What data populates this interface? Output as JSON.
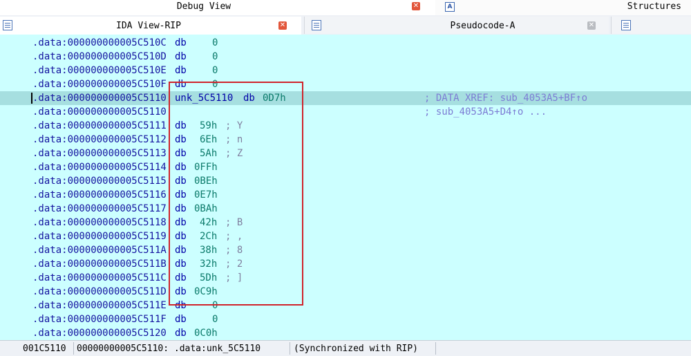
{
  "tabs_top": {
    "debug_view": "Debug View",
    "structures": "Structures"
  },
  "tabs": {
    "ida_view": "IDA View-RIP",
    "pseudocode": "Pseudocode-A"
  },
  "listing": {
    "lines": [
      {
        "addr": ".data:000000000005C510C",
        "ins": "db",
        "op": "0",
        "cmt": ""
      },
      {
        "addr": ".data:000000000005C510D",
        "ins": "db",
        "op": "0",
        "cmt": ""
      },
      {
        "addr": ".data:000000000005C510E",
        "ins": "db",
        "op": "0",
        "cmt": ""
      },
      {
        "addr": ".data:000000000005C510F",
        "ins": "db",
        "op": "0",
        "cmt": ""
      },
      {
        "addr": ".data:000000000005C5110",
        "name": "unk_5C5110",
        "ins": "db",
        "op": "0D7h",
        "xref": "; DATA XREF: sub_4053A5+BF↑o",
        "current": true
      },
      {
        "addr": ".data:000000000005C5110",
        "xref": "; sub_4053A5+D4↑o ..."
      },
      {
        "addr": ".data:000000000005C5111",
        "ins": "db",
        "op": "59h",
        "cmt": "; Y"
      },
      {
        "addr": ".data:000000000005C5112",
        "ins": "db",
        "op": "6Eh",
        "cmt": "; n"
      },
      {
        "addr": ".data:000000000005C5113",
        "ins": "db",
        "op": "5Ah",
        "cmt": "; Z"
      },
      {
        "addr": ".data:000000000005C5114",
        "ins": "db",
        "op": "0FFh",
        "cmt": ""
      },
      {
        "addr": ".data:000000000005C5115",
        "ins": "db",
        "op": "0BEh",
        "cmt": ""
      },
      {
        "addr": ".data:000000000005C5116",
        "ins": "db",
        "op": "0E7h",
        "cmt": ""
      },
      {
        "addr": ".data:000000000005C5117",
        "ins": "db",
        "op": "0BAh",
        "cmt": ""
      },
      {
        "addr": ".data:000000000005C5118",
        "ins": "db",
        "op": "42h",
        "cmt": "; B"
      },
      {
        "addr": ".data:000000000005C5119",
        "ins": "db",
        "op": "2Ch",
        "cmt": "; ,"
      },
      {
        "addr": ".data:000000000005C511A",
        "ins": "db",
        "op": "38h",
        "cmt": "; 8"
      },
      {
        "addr": ".data:000000000005C511B",
        "ins": "db",
        "op": "32h",
        "cmt": "; 2"
      },
      {
        "addr": ".data:000000000005C511C",
        "ins": "db",
        "op": "5Dh",
        "cmt": "; ]"
      },
      {
        "addr": ".data:000000000005C511D",
        "ins": "db",
        "op": "0C9h",
        "cmt": ""
      },
      {
        "addr": ".data:000000000005C511E",
        "ins": "db",
        "op": "0",
        "cmt": ""
      },
      {
        "addr": ".data:000000000005C511F",
        "ins": "db",
        "op": "0",
        "cmt": ""
      },
      {
        "addr": ".data:000000000005C5120",
        "ins": "db",
        "op": "0C0h",
        "cmt": ""
      }
    ]
  },
  "status": {
    "offset": "001C5110",
    "location": "00000000005C5110: .data:unk_5C5110",
    "sync": "(Synchronized with RIP)"
  },
  "colors": {
    "listing_bg": "#ccffff",
    "address": "#1414a0",
    "operand": "#0a7a6a",
    "xref": "#7c7cd4",
    "highlight_box": "#d0222a"
  }
}
